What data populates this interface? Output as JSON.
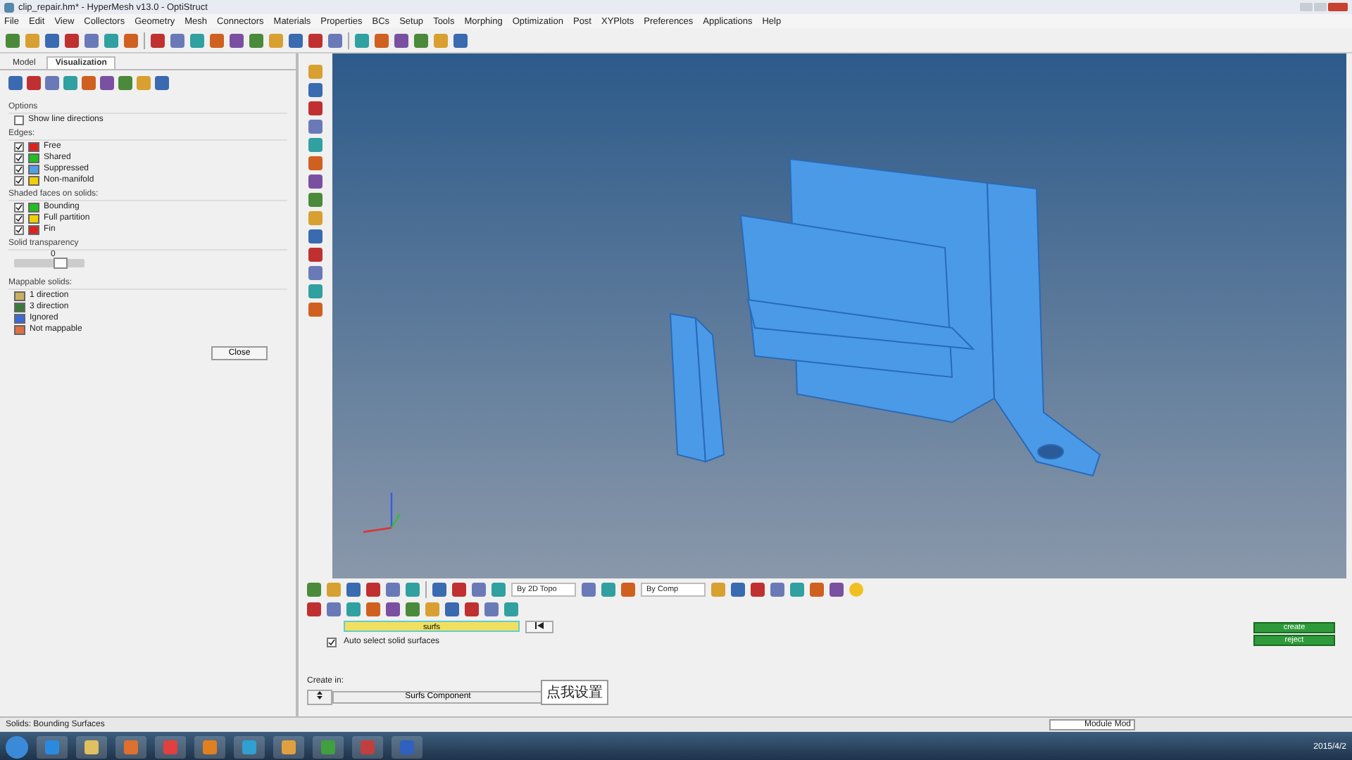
{
  "window": {
    "title": "clip_repair.hm* - HyperMesh v13.0 - OptiStruct"
  },
  "menu": [
    "File",
    "Edit",
    "View",
    "Collectors",
    "Geometry",
    "Mesh",
    "Connectors",
    "Materials",
    "Properties",
    "BCs",
    "Setup",
    "Tools",
    "Morphing",
    "Optimization",
    "Post",
    "XYPlots",
    "Preferences",
    "Applications",
    "Help"
  ],
  "panel": {
    "tabs": [
      {
        "label": "Model",
        "selected": false
      },
      {
        "label": "Visualization",
        "selected": true
      }
    ],
    "options_heading": "Options",
    "show_line_directions": {
      "label": "Show line directions",
      "checked": false
    },
    "edges_heading": "Edges:",
    "edges": [
      {
        "label": "Free",
        "checked": true,
        "color": "#e02020"
      },
      {
        "label": "Shared",
        "checked": true,
        "color": "#20c020"
      },
      {
        "label": "Suppressed",
        "checked": true,
        "color": "#50a0e8"
      },
      {
        "label": "Non-manifold",
        "checked": true,
        "color": "#f0d000"
      }
    ],
    "shaded_heading": "Shaded faces on solids:",
    "shaded": [
      {
        "label": "Bounding",
        "checked": true,
        "color": "#20c020"
      },
      {
        "label": "Full partition",
        "checked": true,
        "color": "#f0d000"
      },
      {
        "label": "Fin",
        "checked": true,
        "color": "#e02020"
      }
    ],
    "transparency": {
      "label": "Solid transparency",
      "reading": "0",
      "level": 0.7
    },
    "mappable_heading": "Mappable solids:",
    "mappable": [
      {
        "label": "1 direction",
        "color": "#c8b060"
      },
      {
        "label": "3 direction",
        "color": "#3a7a3a"
      },
      {
        "label": "Ignored",
        "color": "#3a6ad8"
      },
      {
        "label": "Not mappable",
        "color": "#e07040"
      }
    ],
    "close_button": "Close"
  },
  "bottom_panel": {
    "dropdowns": [
      "By 2D Topo",
      "By Comp"
    ],
    "selector": "surfs",
    "auto_select": {
      "label": "Auto select solid surfaces",
      "checked": true
    },
    "create_in_label": "Create in:",
    "component_button": "Surfs Component",
    "buttons": [
      "create",
      "reject"
    ]
  },
  "tooltip": "点我设置",
  "status_bar": {
    "message": "Solids: Bounding Surfaces",
    "module": "Module Mod"
  },
  "taskbar": {
    "date": "2015/4/2"
  }
}
